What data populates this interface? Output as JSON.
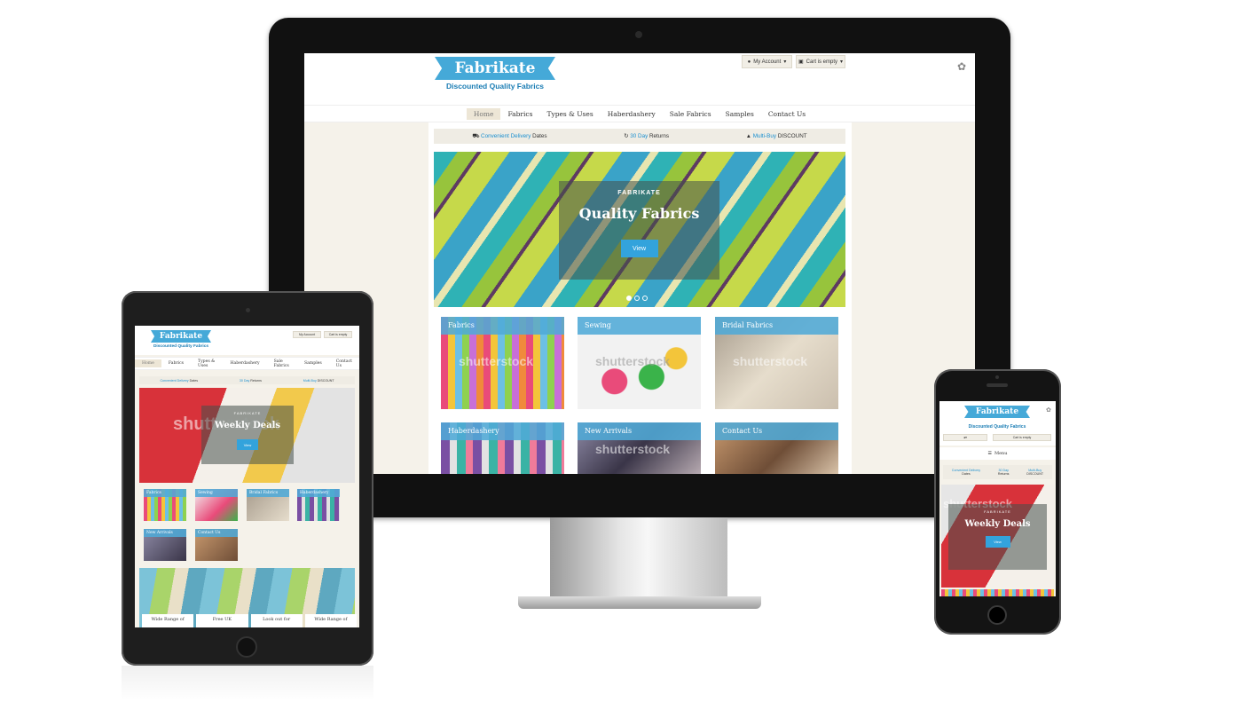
{
  "brand": {
    "name": "Fabrikate",
    "tagline": "Discounted Quality Fabrics",
    "accent": "#45a9d8",
    "link_color": "#1a8fd0"
  },
  "header": {
    "account_label": "My Account",
    "cart_label": "Cart is empty"
  },
  "nav": [
    "Home",
    "Fabrics",
    "Types & Uses",
    "Haberdashery",
    "Sale Fabrics",
    "Samples",
    "Contact Us"
  ],
  "infobar": {
    "delivery_hl": "Convenient Delivery",
    "delivery_rest": "Dates",
    "returns_hl": "30 Day",
    "returns_rest": "Returns",
    "discount_hl": "Multi-Buy",
    "discount_rest": "DISCOUNT"
  },
  "desktop": {
    "hero_kicker": "FABRIKATE",
    "hero_title": "Quality Fabrics",
    "hero_button": "View",
    "tiles": [
      "Fabrics",
      "Sewing",
      "Bridal Fabrics",
      "Haberdashery",
      "New Arrivals",
      "Contact Us"
    ],
    "watermark": "shutterstock"
  },
  "tablet": {
    "hero_kicker": "FABRIKATE",
    "hero_title": "Weekly Deals",
    "hero_button": "View",
    "watermark": "shutterstock",
    "tiles": [
      "Fabrics",
      "Sewing",
      "Bridal Fabrics",
      "Haberdashery",
      "New Arrivals",
      "Contact Us"
    ],
    "bottom_cards": [
      "Wide Range of",
      "Free UK",
      "Look out for",
      "Wide Range of"
    ]
  },
  "phone": {
    "menu_label": "Menu",
    "hero_kicker": "FABRIKATE",
    "hero_title": "Weekly Deals",
    "hero_button": "View",
    "watermark": "shutterstock"
  }
}
